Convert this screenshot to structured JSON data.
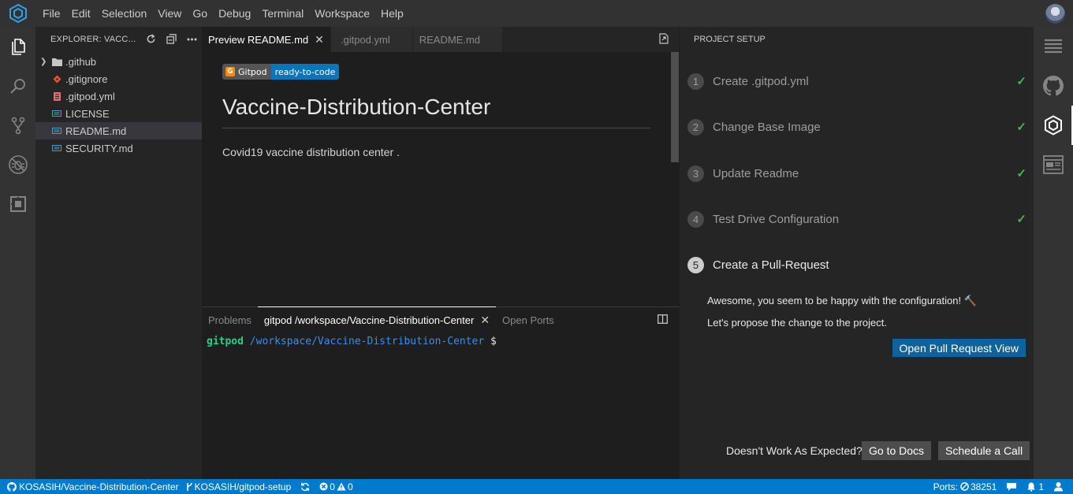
{
  "menubar": {
    "items": [
      "File",
      "Edit",
      "Selection",
      "View",
      "Go",
      "Debug",
      "Terminal",
      "Workspace",
      "Help"
    ]
  },
  "activity_bar": [
    "explorer-icon",
    "search-icon",
    "source-control-icon",
    "debug-icon",
    "extensions-icon"
  ],
  "explorer": {
    "title": "EXPLORER: VACC...",
    "files": [
      {
        "name": ".github",
        "type": "folder"
      },
      {
        "name": ".gitignore",
        "type": "git"
      },
      {
        "name": ".gitpod.yml",
        "type": "yaml"
      },
      {
        "name": "LICENSE",
        "type": "text"
      },
      {
        "name": "README.md",
        "type": "markdown",
        "selected": true
      },
      {
        "name": "SECURITY.md",
        "type": "markdown"
      }
    ]
  },
  "editor": {
    "tabs": [
      {
        "label": "Preview README.md",
        "active": true,
        "closable": true
      },
      {
        "label": ".gitpod.yml",
        "active": false
      },
      {
        "label": "README.md",
        "active": false
      }
    ],
    "badge_left": "Gitpod",
    "badge_right": "ready-to-code",
    "heading": "Vaccine-Distribution-Center",
    "paragraph": "Covid19 vaccine distribution center ."
  },
  "panel": {
    "tabs": [
      {
        "label": "Problems",
        "active": false
      },
      {
        "label": "gitpod /workspace/Vaccine-Distribution-Center",
        "active": true
      },
      {
        "label": "Open Ports",
        "active": false
      }
    ],
    "terminal": {
      "user": "gitpod",
      "path": "/workspace/Vaccine-Distribution-Center",
      "prompt": "$"
    }
  },
  "setup": {
    "title": "PROJECT SETUP",
    "steps": [
      {
        "num": "1",
        "label": "Create .gitpod.yml",
        "done": true
      },
      {
        "num": "2",
        "label": "Change Base Image",
        "done": true
      },
      {
        "num": "3",
        "label": "Update Readme",
        "done": true
      },
      {
        "num": "4",
        "label": "Test Drive Configuration",
        "done": true
      },
      {
        "num": "5",
        "label": "Create a Pull-Request",
        "done": false
      }
    ],
    "check_glyph": "✓",
    "message1": "Awesome, you seem to be happy with the configuration! 🔨",
    "message2": "Let's propose the change to the project.",
    "open_pr_button": "Open Pull Request View",
    "footer_question": "Doesn't Work As Expected?",
    "docs_button": "Go to Docs",
    "call_button": "Schedule a Call"
  },
  "right_bar": [
    "outline-icon",
    "github-icon",
    "gitpod-cube-icon",
    "browser-preview-icon"
  ],
  "statusbar": {
    "repo": "KOSASIH/Vaccine-Distribution-Center",
    "branch": "KOSASIH/gitpod-setup",
    "errors": "0",
    "warnings": "0",
    "ports_label": "Ports:",
    "port": "38251",
    "notifications": "1"
  },
  "colors": {
    "accent": "#007acc",
    "check": "#3fb950",
    "primary_button": "#0e639c"
  }
}
